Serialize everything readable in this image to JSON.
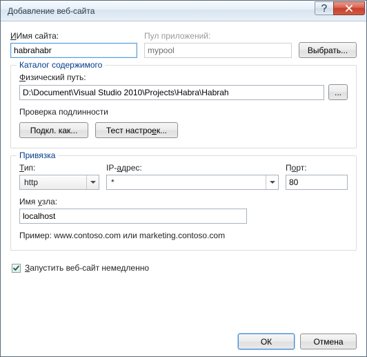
{
  "window": {
    "title": "Добавление веб-сайта"
  },
  "siteName": {
    "label": "Имя сайта:",
    "value": "habrahabr"
  },
  "appPool": {
    "label": "Пул приложений:",
    "value": "mypool",
    "selectBtn": "Выбрать..."
  },
  "content": {
    "legend": "Каталог содержимого",
    "physPathLabel": "Физический путь:",
    "physPathValue": "D:\\Document\\Visual Studio 2010\\Projects\\Habra\\Habrah",
    "browseBtn": "...",
    "authCheckLabel": "Проверка подлинности",
    "connectBtn": "Подкл. как...",
    "testBtn": "Тест настроек..."
  },
  "binding": {
    "legend": "Привязка",
    "typeLabel": "Тип:",
    "typeValue": "http",
    "ipLabel": "IP-адрес:",
    "ipValue": "*",
    "portLabel": "Порт:",
    "portValue": "80",
    "hostLabel": "Имя узла:",
    "hostValue": "localhost",
    "example": "Пример: www.contoso.com или marketing.contoso.com"
  },
  "startNow": {
    "label": "Запустить веб-сайт немедленно",
    "checked": true
  },
  "footer": {
    "ok": "ОК",
    "cancel": "Отмена"
  }
}
